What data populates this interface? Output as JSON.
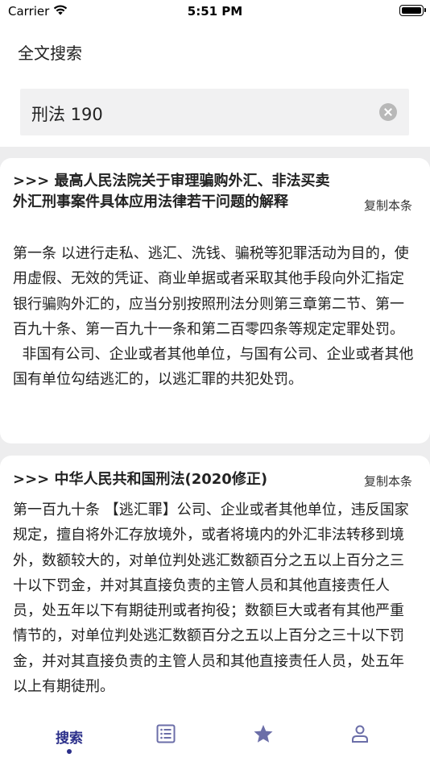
{
  "status_bar": {
    "carrier": "Carrier",
    "time": "5:51 PM"
  },
  "header": {
    "title": "全文搜索"
  },
  "search": {
    "value": "刑法 190"
  },
  "results": [
    {
      "title": ">>> 最高人民法院关于审理骗购外汇、非法买卖外汇刑事案件具体应用法律若干问题的解释",
      "copy_label": "复制本条",
      "paragraphs": [
        "第一条 以进行走私、逃汇、洗钱、骗税等犯罪活动为目的，使用虚假、无效的凭证、商业单据或者采取其他手段向外汇指定银行骗购外汇的，应当分别按照刑法分则第三章第二节、第一百九十条、第一百九十一条和第二百零四条等规定定罪处罚。",
        "  非国有公司、企业或者其他单位，与国有公司、企业或者其他国有单位勾结逃汇的，以逃汇罪的共犯处罚。"
      ]
    },
    {
      "title": ">>> 中华人民共和国刑法(2020修正)",
      "copy_label": "复制本条",
      "paragraphs": [
        "第一百九十条 【逃汇罪】公司、企业或者其他单位，违反国家规定，擅自将外汇存放境外，或者将境内的外汇非法转移到境外，数额较大的，对单位判处逃汇数额百分之五以上百分之三十以下罚金，并对其直接负责的主管人员和其他直接责任人员，处五年以下有期徒刑或者拘役；数额巨大或者有其他严重情节的，对单位判处逃汇数额百分之五以上百分之三十以下罚金，并对其直接负责的主管人员和其他直接责任人员，处五年以上有期徒刑。"
      ]
    }
  ],
  "tab_bar": {
    "tabs": [
      {
        "label": "搜索",
        "icon": "search-tab",
        "active": true
      },
      {
        "label": "",
        "icon": "list-icon",
        "active": false
      },
      {
        "label": "",
        "icon": "star-icon",
        "active": false
      },
      {
        "label": "",
        "icon": "person-icon",
        "active": false
      }
    ]
  },
  "colors": {
    "accent": "#2b2f8a",
    "icon_inactive": "#6b6ea8",
    "background": "#ededee"
  }
}
